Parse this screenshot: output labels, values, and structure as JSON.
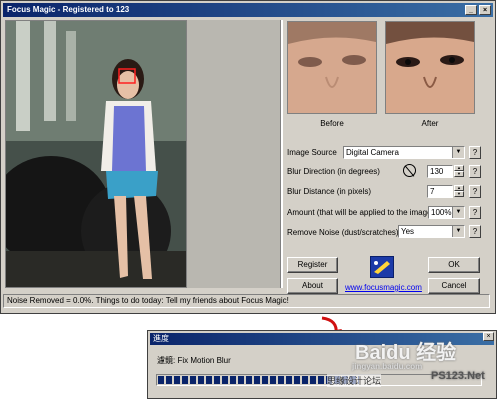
{
  "window": {
    "title": "Focus Magic - Registered to 123"
  },
  "title_buttons": {
    "minimize": "_",
    "close": "×"
  },
  "preview": {
    "before_label": "Before",
    "after_label": "After"
  },
  "settings": {
    "image_source": {
      "label": "Image Source",
      "value": "Digital Camera"
    },
    "blur_direction": {
      "label": "Blur Direction (in degrees)",
      "value": "130"
    },
    "blur_distance": {
      "label": "Blur Distance (in pixels)",
      "value": "7"
    },
    "amount": {
      "label": "Amount (that will be applied to the image)",
      "value": "100%"
    },
    "remove_noise": {
      "label": "Remove Noise (dust/scratches)",
      "value": "Yes"
    },
    "help_label": "?"
  },
  "buttons": {
    "register": "Register",
    "about": "About",
    "ok": "OK",
    "cancel": "Cancel"
  },
  "link": "www.focusmagic.com",
  "status": "Noise Removed = 0.0%. Things to do today: Tell my friends about Focus Magic!",
  "progress_dialog": {
    "title": "進度",
    "filter_text": "濾鏡: Fix Motion Blur",
    "close": "×",
    "progress": 0.62
  },
  "watermarks": {
    "baidu": "Baidu 经验",
    "jingyan": "jingyan.baidu.com",
    "forum": "思缘设计论坛",
    "ps": "PS123.Net"
  },
  "colors": {
    "titlebar": "#0a246a",
    "progress": "#0a246a",
    "link": "#0000ee",
    "arrow": "#d01010"
  }
}
